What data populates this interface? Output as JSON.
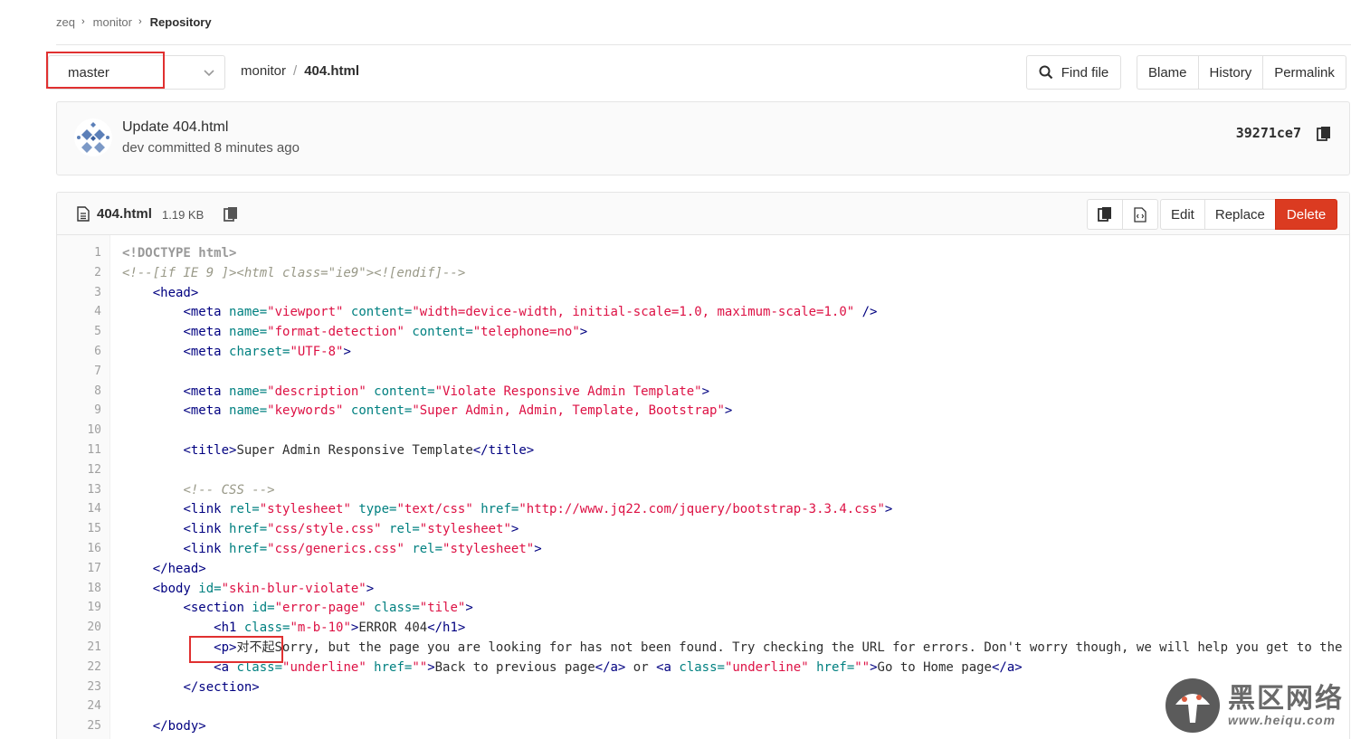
{
  "breadcrumb": [
    {
      "label": "zeq",
      "current": false
    },
    {
      "label": "monitor",
      "current": false
    },
    {
      "label": "Repository",
      "current": true
    }
  ],
  "branch": {
    "value": "master"
  },
  "path": {
    "repo": "monitor",
    "separator": "/",
    "file": "404.html"
  },
  "toolbar": {
    "find_file": "Find file",
    "blame": "Blame",
    "history": "History",
    "permalink": "Permalink"
  },
  "commit": {
    "title": "Update 404.html",
    "meta": "dev committed 8 minutes ago",
    "sha": "39271ce7"
  },
  "file": {
    "name": "404.html",
    "size": "1.19 KB",
    "edit": "Edit",
    "replace": "Replace",
    "delete": "Delete"
  },
  "colors": {
    "danger": "#db3b21",
    "highlight": "#e03030"
  },
  "icons": {
    "find": "search-icon",
    "copy": "clipboard-icon",
    "file": "file-icon",
    "raw": "raw-file-icon",
    "download": "code-file-icon"
  },
  "code_lines": [
    [
      [
        "t-doc",
        "<!DOCTYPE html>"
      ]
    ],
    [
      [
        "t-com",
        "<!--[if IE 9 ]><html class=\"ie9\"><![endif]-->"
      ]
    ],
    [
      [
        "t-txt",
        "    "
      ],
      [
        "t-tag",
        "<head>"
      ]
    ],
    [
      [
        "t-txt",
        "        "
      ],
      [
        "t-tag",
        "<meta "
      ],
      [
        "t-attr",
        "name="
      ],
      [
        "t-str",
        "\"viewport\""
      ],
      [
        "t-attr",
        " content="
      ],
      [
        "t-str",
        "\"width=device-width, initial-scale=1.0, maximum-scale=1.0\""
      ],
      [
        "t-tag",
        " />"
      ]
    ],
    [
      [
        "t-txt",
        "        "
      ],
      [
        "t-tag",
        "<meta "
      ],
      [
        "t-attr",
        "name="
      ],
      [
        "t-str",
        "\"format-detection\""
      ],
      [
        "t-attr",
        " content="
      ],
      [
        "t-str",
        "\"telephone=no\""
      ],
      [
        "t-tag",
        ">"
      ]
    ],
    [
      [
        "t-txt",
        "        "
      ],
      [
        "t-tag",
        "<meta "
      ],
      [
        "t-attr",
        "charset="
      ],
      [
        "t-str",
        "\"UTF-8\""
      ],
      [
        "t-tag",
        ">"
      ]
    ],
    [],
    [
      [
        "t-txt",
        "        "
      ],
      [
        "t-tag",
        "<meta "
      ],
      [
        "t-attr",
        "name="
      ],
      [
        "t-str",
        "\"description\""
      ],
      [
        "t-attr",
        " content="
      ],
      [
        "t-str",
        "\"Violate Responsive Admin Template\""
      ],
      [
        "t-tag",
        ">"
      ]
    ],
    [
      [
        "t-txt",
        "        "
      ],
      [
        "t-tag",
        "<meta "
      ],
      [
        "t-attr",
        "name="
      ],
      [
        "t-str",
        "\"keywords\""
      ],
      [
        "t-attr",
        " content="
      ],
      [
        "t-str",
        "\"Super Admin, Admin, Template, Bootstrap\""
      ],
      [
        "t-tag",
        ">"
      ]
    ],
    [],
    [
      [
        "t-txt",
        "        "
      ],
      [
        "t-tag",
        "<title>"
      ],
      [
        "t-txt",
        "Super Admin Responsive Template"
      ],
      [
        "t-tag",
        "</title>"
      ]
    ],
    [],
    [
      [
        "t-txt",
        "        "
      ],
      [
        "t-com",
        "<!-- CSS -->"
      ]
    ],
    [
      [
        "t-txt",
        "        "
      ],
      [
        "t-tag",
        "<link "
      ],
      [
        "t-attr",
        "rel="
      ],
      [
        "t-str",
        "\"stylesheet\""
      ],
      [
        "t-attr",
        " type="
      ],
      [
        "t-str",
        "\"text/css\""
      ],
      [
        "t-attr",
        " href="
      ],
      [
        "t-str",
        "\"http://www.jq22.com/jquery/bootstrap-3.3.4.css\""
      ],
      [
        "t-tag",
        ">"
      ]
    ],
    [
      [
        "t-txt",
        "        "
      ],
      [
        "t-tag",
        "<link "
      ],
      [
        "t-attr",
        "href="
      ],
      [
        "t-str",
        "\"css/style.css\""
      ],
      [
        "t-attr",
        " rel="
      ],
      [
        "t-str",
        "\"stylesheet\""
      ],
      [
        "t-tag",
        ">"
      ]
    ],
    [
      [
        "t-txt",
        "        "
      ],
      [
        "t-tag",
        "<link "
      ],
      [
        "t-attr",
        "href="
      ],
      [
        "t-str",
        "\"css/generics.css\""
      ],
      [
        "t-attr",
        " rel="
      ],
      [
        "t-str",
        "\"stylesheet\""
      ],
      [
        "t-tag",
        ">"
      ]
    ],
    [
      [
        "t-txt",
        "    "
      ],
      [
        "t-tag",
        "</head>"
      ]
    ],
    [
      [
        "t-txt",
        "    "
      ],
      [
        "t-tag",
        "<body "
      ],
      [
        "t-attr",
        "id="
      ],
      [
        "t-str",
        "\"skin-blur-violate\""
      ],
      [
        "t-tag",
        ">"
      ]
    ],
    [
      [
        "t-txt",
        "        "
      ],
      [
        "t-tag",
        "<section "
      ],
      [
        "t-attr",
        "id="
      ],
      [
        "t-str",
        "\"error-page\""
      ],
      [
        "t-attr",
        " class="
      ],
      [
        "t-str",
        "\"tile\""
      ],
      [
        "t-tag",
        ">"
      ]
    ],
    [
      [
        "t-txt",
        "            "
      ],
      [
        "t-tag",
        "<h1 "
      ],
      [
        "t-attr",
        "class="
      ],
      [
        "t-str",
        "\"m-b-10\""
      ],
      [
        "t-tag",
        ">"
      ],
      [
        "t-txt",
        "ERROR 404"
      ],
      [
        "t-tag",
        "</h1>"
      ]
    ],
    [
      [
        "t-txt",
        "            "
      ],
      [
        "t-tag",
        "<p>"
      ],
      [
        "t-txt",
        "对不起Sorry, but the page you are looking for has not been found. Try checking the URL for errors. Don't worry though, we will help you get to the rig"
      ]
    ],
    [
      [
        "t-txt",
        "            "
      ],
      [
        "t-tag",
        "<a "
      ],
      [
        "t-attr",
        "class="
      ],
      [
        "t-str",
        "\"underline\""
      ],
      [
        "t-attr",
        " href="
      ],
      [
        "t-str",
        "\"\""
      ],
      [
        "t-tag",
        ">"
      ],
      [
        "t-txt",
        "Back to previous page"
      ],
      [
        "t-tag",
        "</a>"
      ],
      [
        "t-txt",
        " or "
      ],
      [
        "t-tag",
        "<a "
      ],
      [
        "t-attr",
        "class="
      ],
      [
        "t-str",
        "\"underline\""
      ],
      [
        "t-attr",
        " href="
      ],
      [
        "t-str",
        "\"\""
      ],
      [
        "t-tag",
        ">"
      ],
      [
        "t-txt",
        "Go to Home page"
      ],
      [
        "t-tag",
        "</a>"
      ]
    ],
    [
      [
        "t-txt",
        "        "
      ],
      [
        "t-tag",
        "</section>"
      ]
    ],
    [],
    [
      [
        "t-txt",
        "    "
      ],
      [
        "t-tag",
        "</body>"
      ]
    ]
  ],
  "watermark": {
    "cn": "黑区网络",
    "url": "www.heiqu.com"
  }
}
